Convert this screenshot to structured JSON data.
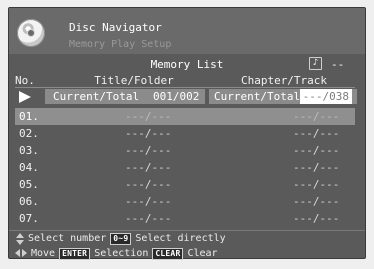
{
  "header": {
    "title": "Disc Navigator",
    "subtitle": "Memory Play Setup"
  },
  "list": {
    "title": "Memory List",
    "note_icon": "music-note-icon",
    "note_glyph": "♪",
    "mode_value": "--",
    "columns": {
      "no": "No.",
      "title_folder": "Title/Folder",
      "chapter_track": "Chapter/Track"
    },
    "current": {
      "title_label": "Current/Total",
      "title_value": "001/002",
      "chapter_label": "Current/Total",
      "chapter_value": "---/038"
    },
    "rows": [
      {
        "num": "01.",
        "title": "---/---",
        "chapter": "---/---"
      },
      {
        "num": "02.",
        "title": "---/---",
        "chapter": "---/---"
      },
      {
        "num": "03.",
        "title": "---/---",
        "chapter": "---/---"
      },
      {
        "num": "04.",
        "title": "---/---",
        "chapter": "---/---"
      },
      {
        "num": "05.",
        "title": "---/---",
        "chapter": "---/---"
      },
      {
        "num": "06.",
        "title": "---/---",
        "chapter": "---/---"
      },
      {
        "num": "07.",
        "title": "---/---",
        "chapter": "---/---"
      }
    ]
  },
  "help": {
    "line1_a": "Select number",
    "key_digits": "0~9",
    "line1_b": "Select directly",
    "line2_a": "Move",
    "key_enter": "ENTER",
    "line2_b": "Selection",
    "key_clear": "CLEAR",
    "line2_c": "Clear"
  },
  "colors": {
    "panel": "#5a5a5a",
    "highlight": "#8f8f8f",
    "text": "#f2f2f2"
  }
}
